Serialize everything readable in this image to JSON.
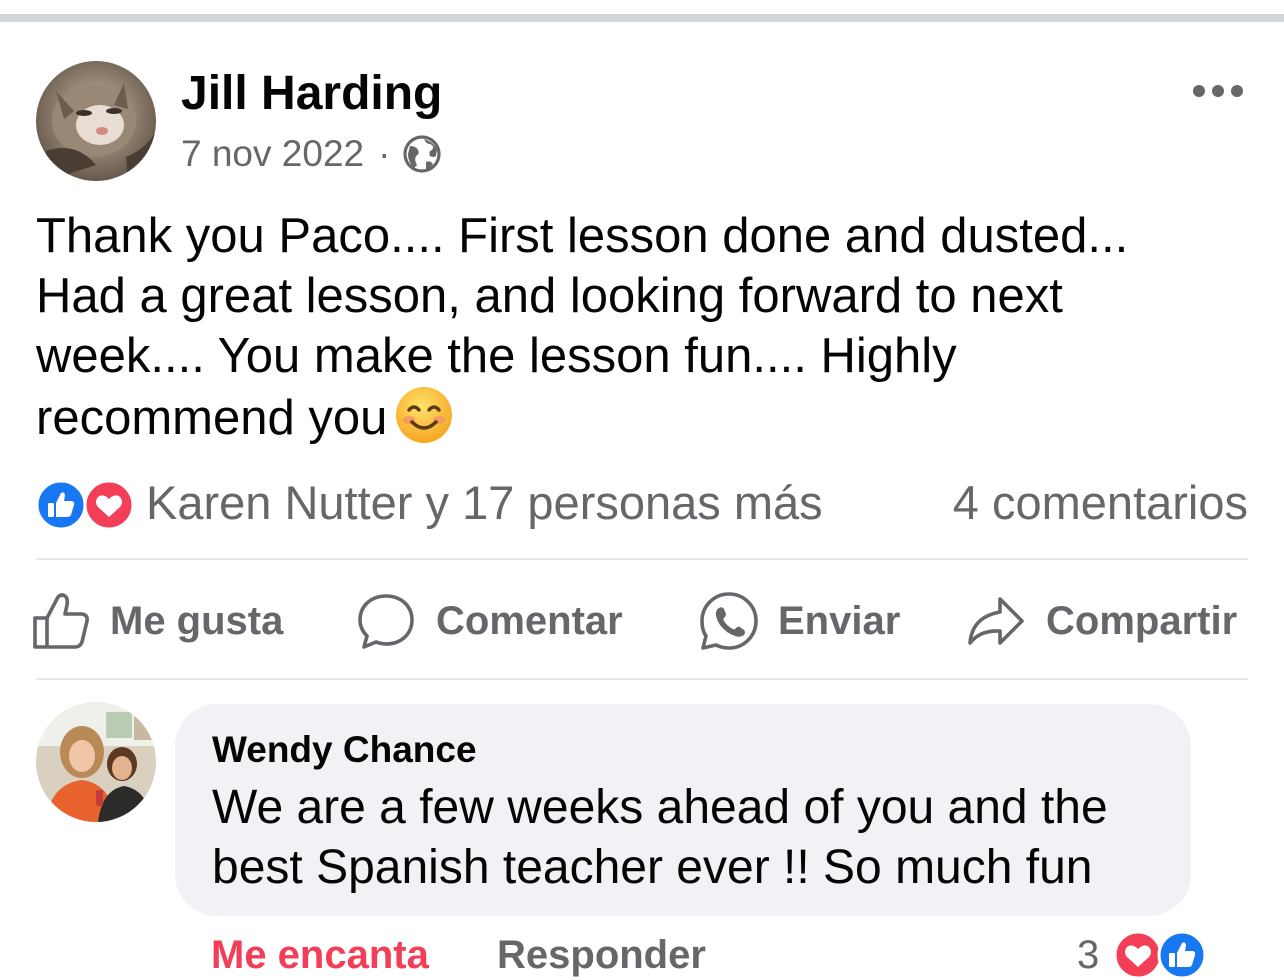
{
  "post": {
    "author": "Jill Harding",
    "date": "7 nov 2022",
    "separator": "·",
    "audience_icon": "globe-icon",
    "text_lines": [
      "Thank you Paco.... First lesson done and dusted...",
      "Had a great lesson, and looking forward to next",
      "week.... You make the lesson fun.... Highly",
      "recommend you"
    ],
    "emoji": "smiling-face-icon"
  },
  "reactions": {
    "icons": [
      "like-icon",
      "love-icon"
    ],
    "summary": "Karen Nutter y 17 personas más",
    "comments": "4 comentarios"
  },
  "actions": {
    "like": "Me gusta",
    "comment": "Comentar",
    "send": "Enviar",
    "share": "Compartir"
  },
  "comment": {
    "author": "Wendy Chance",
    "text_lines": [
      "We are a few weeks ahead of you and the",
      "best Spanish teacher ever !! So much fun"
    ],
    "reaction_label": "Me encanta",
    "reply_label": "Responder",
    "reaction_count": "3"
  },
  "colors": {
    "like_blue": "#1877f2",
    "love_red": "#f33e58",
    "secondary_text": "#65676b",
    "bubble_bg": "#f0f2f5"
  }
}
